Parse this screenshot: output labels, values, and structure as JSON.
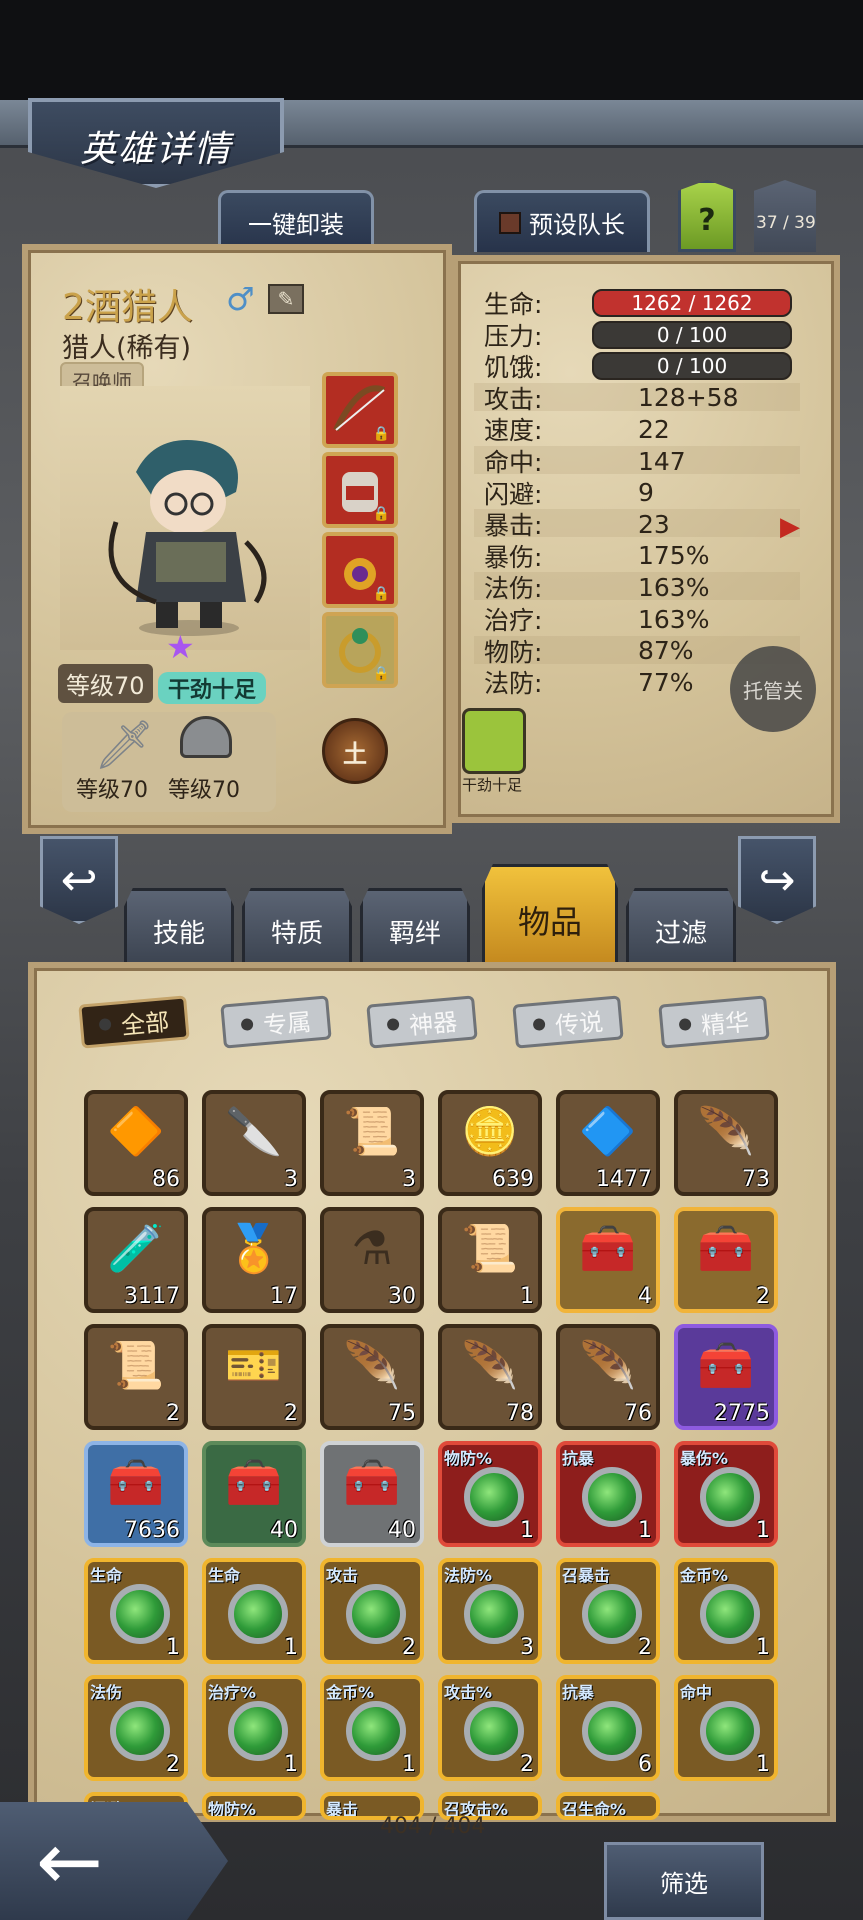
{
  "header": {
    "title": "英雄详情"
  },
  "top_buttons": {
    "unequip_all": "一键卸装",
    "preset_leader": "预设队长",
    "help": "?",
    "hero_counter": "37 / 39"
  },
  "hero": {
    "name": "2酒猎人",
    "class": "猎人(稀有)",
    "role_badge": "召唤师",
    "level": "等级70",
    "trait": "干劲十足",
    "weapon_level": "等级70",
    "armor_level": "等级70",
    "element": "土",
    "gear_slots": [
      "bow-icon",
      "backpack-icon",
      "amulet-icon",
      "ring-icon"
    ]
  },
  "stats": [
    {
      "label": "生命:",
      "value": "1262 / 1262",
      "type": "hp-bar"
    },
    {
      "label": "压力:",
      "value": "0 / 100",
      "type": "dark-bar"
    },
    {
      "label": "饥饿:",
      "value": "0 / 100",
      "type": "dark-bar"
    },
    {
      "label": "攻击:",
      "value": "128+58"
    },
    {
      "label": "速度:",
      "value": "22"
    },
    {
      "label": "命中:",
      "value": "147"
    },
    {
      "label": "闪避:",
      "value": "9"
    },
    {
      "label": "暴击:",
      "value": "23"
    },
    {
      "label": "暴伤:",
      "value": "175%"
    },
    {
      "label": "法伤:",
      "value": "163%"
    },
    {
      "label": "治疗:",
      "value": "163%"
    },
    {
      "label": "物防:",
      "value": "87%"
    },
    {
      "label": "法防:",
      "value": "77%"
    }
  ],
  "auto_button": "托管关",
  "trait_icon_label": "干劲十足",
  "section_tabs": [
    "技能",
    "特质",
    "羁绊",
    "物品",
    "过滤"
  ],
  "active_section": "物品",
  "filter_chips": [
    "全部",
    "专属",
    "神器",
    "传说",
    "精华"
  ],
  "items": [
    {
      "glyph": "🔶",
      "count": "86",
      "style": ""
    },
    {
      "glyph": "🔪",
      "count": "3",
      "style": ""
    },
    {
      "glyph": "📜",
      "count": "3",
      "style": ""
    },
    {
      "glyph": "🪙",
      "count": "639",
      "style": ""
    },
    {
      "glyph": "🔷",
      "count": "1477",
      "style": ""
    },
    {
      "glyph": "🪶",
      "count": "73",
      "style": ""
    },
    {
      "glyph": "🧪",
      "count": "3117",
      "style": ""
    },
    {
      "glyph": "🏅",
      "count": "17",
      "style": ""
    },
    {
      "glyph": "⚗",
      "count": "30",
      "style": ""
    },
    {
      "glyph": "📜",
      "count": "1",
      "style": ""
    },
    {
      "glyph": "🧰",
      "count": "4",
      "style": "gold"
    },
    {
      "glyph": "🧰",
      "count": "2",
      "style": "gold"
    },
    {
      "glyph": "📜",
      "count": "2",
      "style": ""
    },
    {
      "glyph": "🎫",
      "count": "2",
      "style": ""
    },
    {
      "glyph": "🪶",
      "count": "75",
      "style": ""
    },
    {
      "glyph": "🪶",
      "count": "78",
      "style": ""
    },
    {
      "glyph": "🪶",
      "count": "76",
      "style": ""
    },
    {
      "glyph": "🧰",
      "count": "2775",
      "style": "purple"
    },
    {
      "glyph": "🧰",
      "count": "7636",
      "style": "blue"
    },
    {
      "glyph": "🧰",
      "count": "40",
      "style": "green"
    },
    {
      "glyph": "🧰",
      "count": "40",
      "style": "silver"
    },
    {
      "tag": "物防%",
      "count": "1",
      "style": "red",
      "gem": true
    },
    {
      "tag": "抗暴",
      "count": "1",
      "style": "red",
      "gem": true
    },
    {
      "tag": "暴伤%",
      "count": "1",
      "style": "red",
      "gem": true
    },
    {
      "tag": "生命",
      "count": "1",
      "style": "yellow",
      "gem": true
    },
    {
      "tag": "生命",
      "count": "1",
      "style": "yellow",
      "gem": true
    },
    {
      "tag": "攻击",
      "count": "2",
      "style": "yellow",
      "gem": true
    },
    {
      "tag": "法防%",
      "count": "3",
      "style": "yellow",
      "gem": true
    },
    {
      "tag": "召暴击",
      "count": "2",
      "style": "yellow",
      "gem": true
    },
    {
      "tag": "金币%",
      "count": "1",
      "style": "yellow",
      "gem": true
    },
    {
      "tag": "法伤",
      "count": "2",
      "style": "yellow",
      "gem": true
    },
    {
      "tag": "治疗%",
      "count": "1",
      "style": "yellow",
      "gem": true
    },
    {
      "tag": "金币%",
      "count": "1",
      "style": "yellow",
      "gem": true
    },
    {
      "tag": "攻击%",
      "count": "2",
      "style": "yellow",
      "gem": true
    },
    {
      "tag": "抗暴",
      "count": "6",
      "style": "yellow",
      "gem": true
    },
    {
      "tag": "命中",
      "count": "1",
      "style": "yellow",
      "gem": true
    },
    {
      "tag": "闪避",
      "count": "",
      "style": "yellow",
      "gem": true
    },
    {
      "tag": "物防%",
      "count": "",
      "style": "yellow",
      "gem": true
    },
    {
      "tag": "暴击",
      "count": "",
      "style": "yellow",
      "gem": true
    },
    {
      "tag": "召攻击%",
      "count": "",
      "style": "yellow",
      "gem": true
    },
    {
      "tag": "召生命%",
      "count": "",
      "style": "yellow",
      "gem": true
    }
  ],
  "inventory_count": "404 / 404",
  "bottom": {
    "back": "←",
    "filter": "筛选"
  }
}
